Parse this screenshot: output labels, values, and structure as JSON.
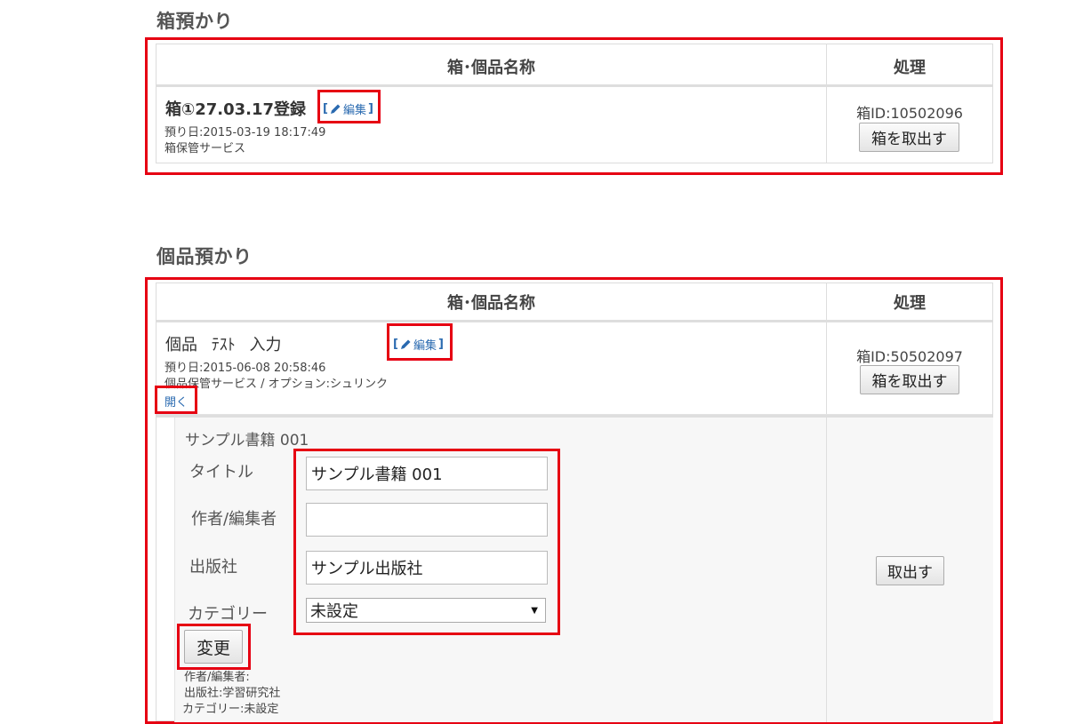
{
  "box_section": {
    "title": "箱預かり",
    "header_name": "箱･個品名称",
    "header_action": "処理",
    "item": {
      "name": "箱①27.03.17登録",
      "edit_label": "編集",
      "deposit_date": "預り日:2015-03-19 18:17:49",
      "service": "箱保管サービス",
      "box_id": "箱ID:10502096",
      "take_out_label": "箱を取出す"
    }
  },
  "item_section": {
    "title": "個品預かり",
    "header_name": "箱･個品名称",
    "header_action": "処理",
    "item": {
      "name": "個品 ﾃｽﾄ 入力",
      "edit_label": "編集",
      "deposit_date": "預り日:2015-06-08 20:58:46",
      "service": "個品保管サービス / オプション:シュリンク",
      "open_label": "開く",
      "box_id": "箱ID:50502097",
      "take_out_label": "箱を取出す"
    },
    "detail": {
      "heading": "サンプル書籍 001",
      "fields": {
        "title_label": "タイトル",
        "title_value": "サンプル書籍 001",
        "author_label": "作者/編集者",
        "author_value": "",
        "publisher_label": "出版社",
        "publisher_value": "サンプル出版社",
        "category_label": "カテゴリー",
        "category_value": "未設定"
      },
      "change_label": "変更",
      "summary_author": "作者/編集者:",
      "summary_publisher": "出版社:学習研究社",
      "summary_category": "カテゴリー:未設定",
      "take_out_label": "取出す"
    }
  },
  "colors": {
    "highlight": "#e60012",
    "link": "#2a6ab0"
  }
}
